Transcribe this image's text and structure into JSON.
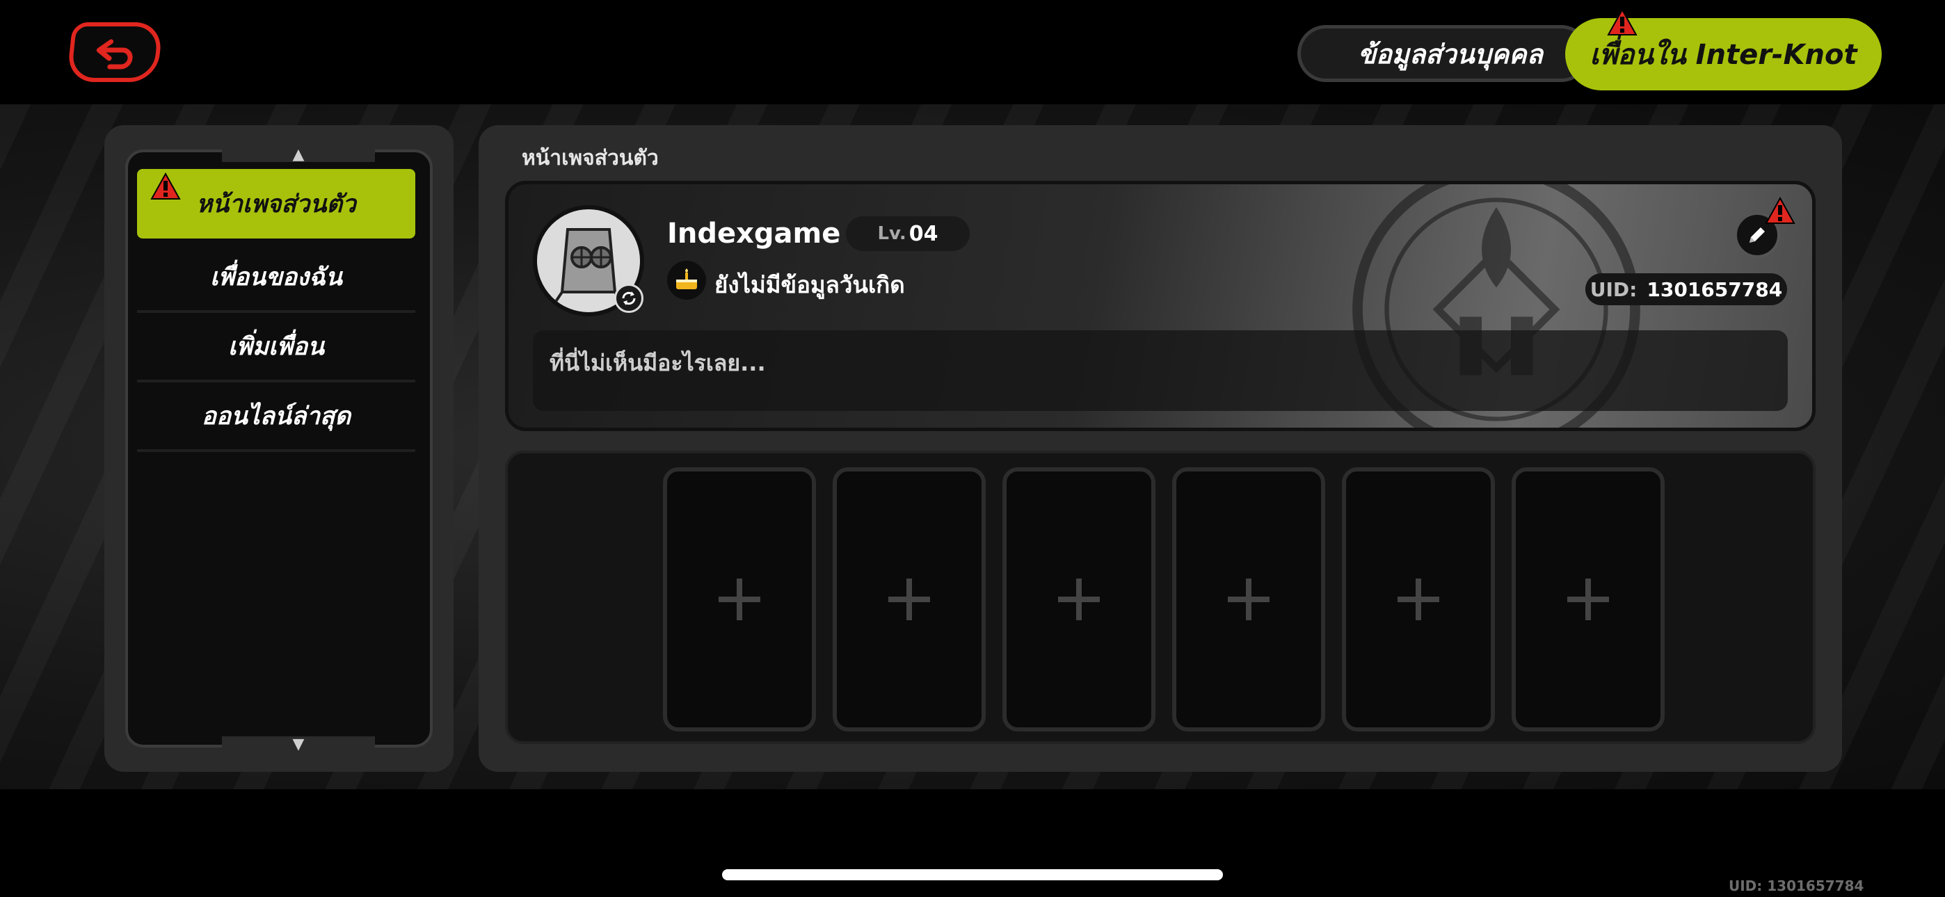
{
  "header": {
    "tab_personal_label": "ข้อมูลส่วนบุคคล",
    "tab_friends_label": "เพื่อนใน Inter-Knot"
  },
  "sidebar": {
    "items": [
      {
        "label": "หน้าเพจส่วนตัว",
        "active": true,
        "alert": true
      },
      {
        "label": "เพื่อนของฉัน",
        "active": false
      },
      {
        "label": "เพิ่มเพื่อน",
        "active": false
      },
      {
        "label": "ออนไลน์ล่าสุด",
        "active": false
      }
    ]
  },
  "panel": {
    "title": "หน้าเพจส่วนตัว",
    "profile": {
      "username": "Indexgame",
      "level_prefix": "Lv.",
      "level_value": "04",
      "birthday_text": "ยังไม่มีข้อมูลวันเกิด",
      "uid_label": "UID:",
      "uid_value": "1301657784",
      "bio": "ที่นี่ไม่เห็นมีอะไรเลย..."
    },
    "showcase_slots": [
      "+",
      "+",
      "+",
      "+",
      "+",
      "+"
    ]
  },
  "footer": {
    "uid_text": "UID: 1301657784"
  },
  "colors": {
    "accent": "#a8c20b",
    "alert": "#e0261f",
    "background": "#000000"
  },
  "icons": {
    "back": "back-arrow-icon",
    "alert": "exclamation-alert-icon",
    "edit": "pencil-icon",
    "birthday": "cake-icon",
    "avatar_swap": "refresh-icon",
    "slot_add": "plus-icon"
  }
}
